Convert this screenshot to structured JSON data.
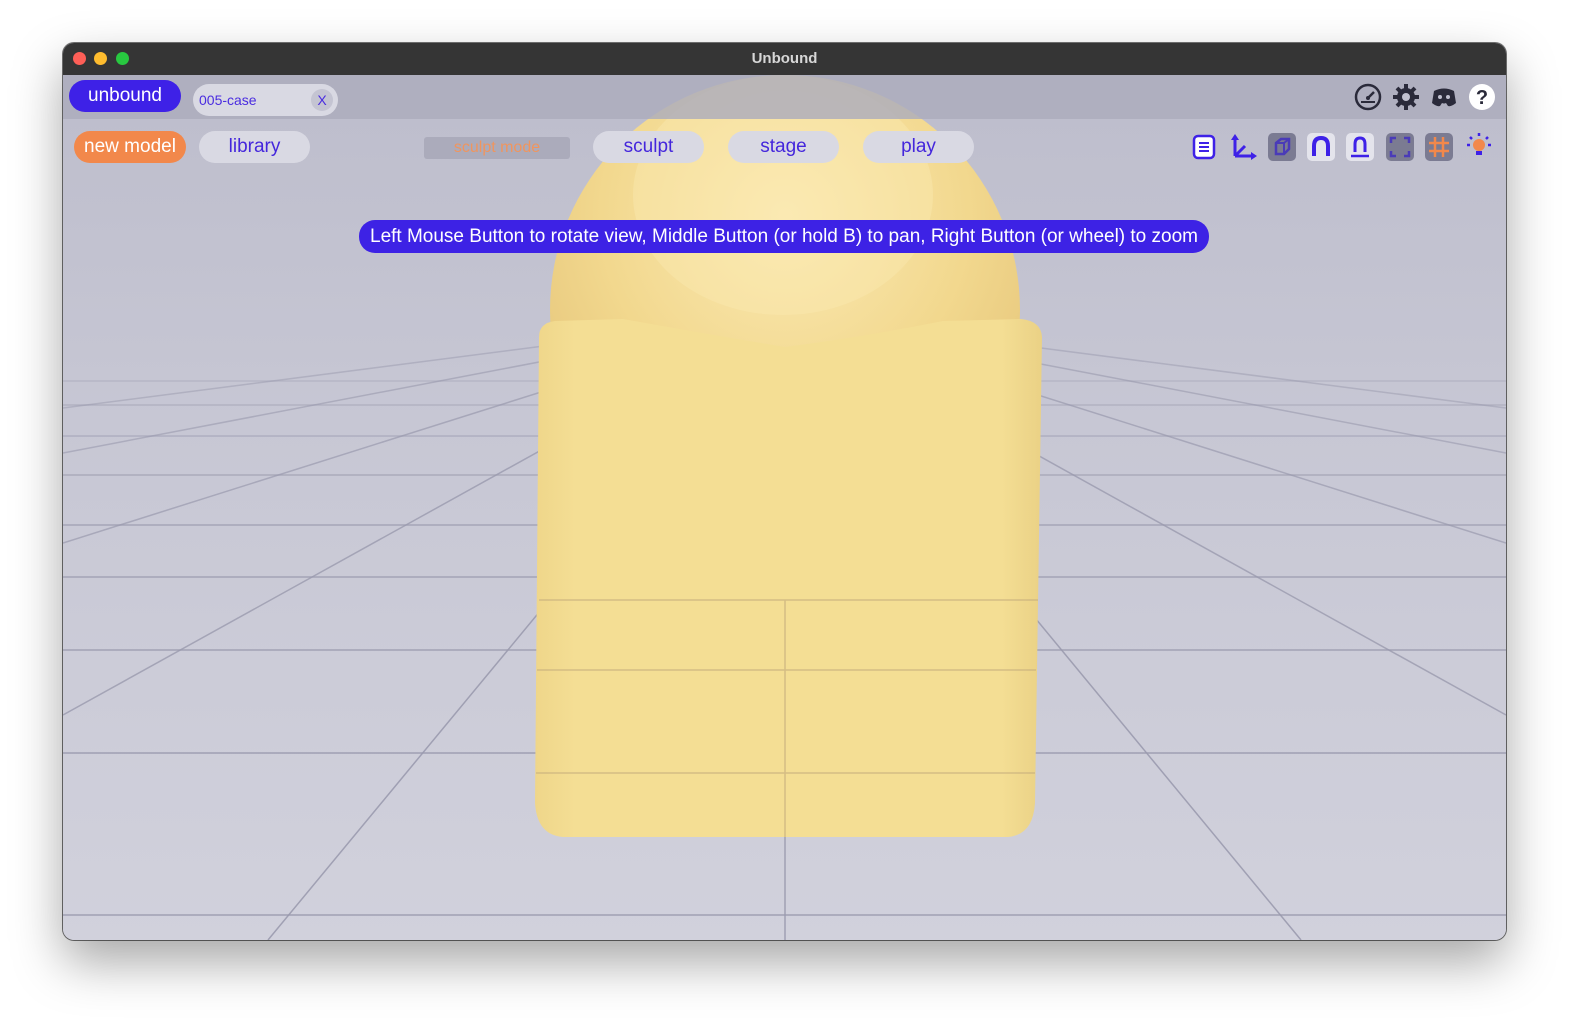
{
  "window": {
    "title": "Unbound"
  },
  "header": {
    "brand_label": "unbound",
    "file_tab": {
      "name": "005-case",
      "close_label": "X"
    },
    "icons": [
      "speedometer-icon",
      "gear-icon",
      "discord-icon",
      "help-icon"
    ]
  },
  "toolbar": {
    "new_model_label": "new model",
    "library_label": "library",
    "mode_label": "sculpt mode",
    "tabs": [
      {
        "label": "sculpt",
        "active": true
      },
      {
        "label": "stage",
        "active": false
      },
      {
        "label": "play",
        "active": false
      }
    ],
    "tool_icons": [
      "list-icon",
      "axes-icon",
      "shading-cube-icon",
      "magnet-icon",
      "snap-icon",
      "frame-icon",
      "grid-icon",
      "light-bulb-icon"
    ]
  },
  "hint": {
    "text": "Left Mouse Button to rotate view, Middle Button (or hold B) to pan, Right Button (or wheel) to zoom"
  },
  "colors": {
    "brand": "#3e21e7",
    "accent_orange": "#f2884b",
    "model": "#f4de94",
    "background": "#cfcfdb"
  }
}
